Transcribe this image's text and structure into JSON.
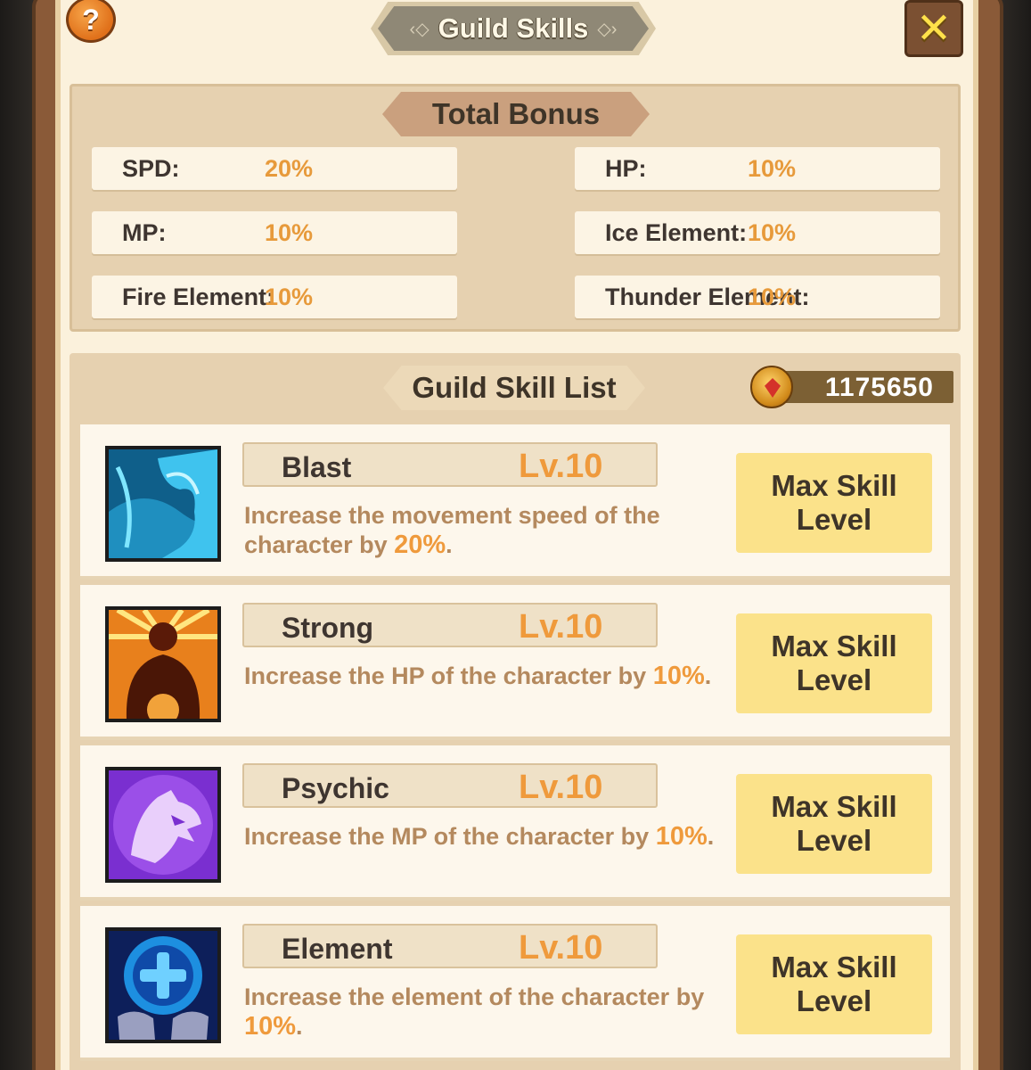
{
  "window": {
    "title": "Guild Skills",
    "help_label": "?",
    "close_label": "✕"
  },
  "bonus": {
    "title": "Total Bonus",
    "stats": [
      {
        "label": "SPD:",
        "value": "20%"
      },
      {
        "label": "HP:",
        "value": "10%"
      },
      {
        "label": "MP:",
        "value": "10%"
      },
      {
        "label": "Ice Element:",
        "value": "10%"
      },
      {
        "label": "Fire Element:",
        "value": "10%"
      },
      {
        "label": "Thunder Element:",
        "value": "10%"
      }
    ]
  },
  "list": {
    "title": "Guild Skill List",
    "currency": {
      "icon": "guild-coin-icon",
      "amount": "1175650"
    },
    "skills": [
      {
        "name": "Blast",
        "level": "Lv.10",
        "desc_prefix": "Increase the movement speed of the character by ",
        "desc_value": "20%",
        "desc_suffix": ".",
        "button": "Max Skill Level",
        "icon": "speed-silhouette-icon"
      },
      {
        "name": "Strong",
        "level": "Lv.10",
        "desc_prefix": "Increase the HP of the character by ",
        "desc_value": "10%",
        "desc_suffix": ".",
        "button": "Max Skill Level",
        "icon": "strength-figure-icon"
      },
      {
        "name": "Psychic",
        "level": "Lv.10",
        "desc_prefix": "Increase the MP of the character by ",
        "desc_value": "10%",
        "desc_suffix": ".",
        "button": "Max Skill Level",
        "icon": "wolf-spirit-icon"
      },
      {
        "name": "Element",
        "level": "Lv.10",
        "desc_prefix": "Increase the element of the character by ",
        "desc_value": "10%",
        "desc_suffix": ".",
        "button": "Max Skill Level",
        "icon": "element-orb-icon"
      }
    ]
  }
}
